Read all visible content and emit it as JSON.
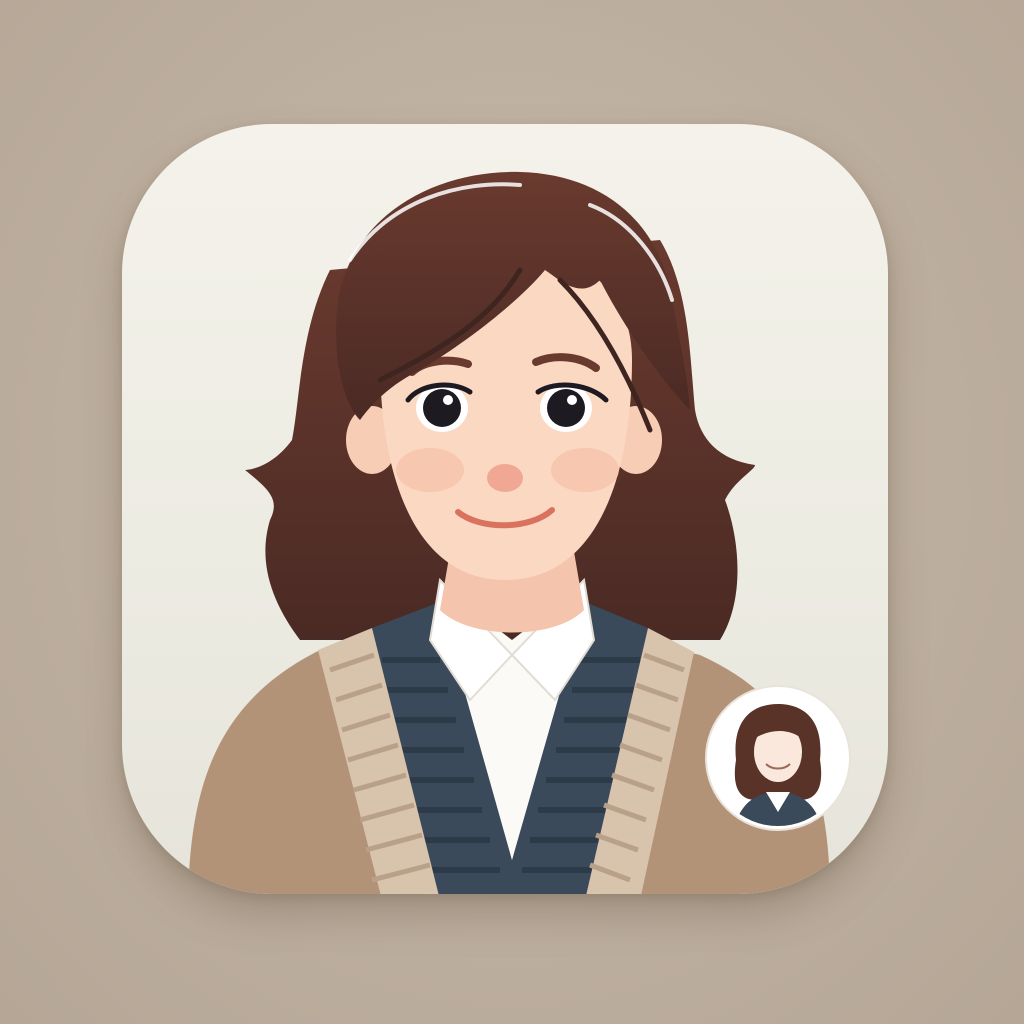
{
  "icon": {
    "subject": "avatar",
    "badge": "avatar-badge"
  },
  "colors": {
    "background": "#bfb1a1",
    "tile": "#f2f0e8",
    "hair": "#5a3328",
    "hair_shadow": "#3e2520",
    "skin": "#fbd8c2",
    "blush": "#f5b9a3",
    "cardigan": "#b39378",
    "cardigan_trim": "#d8c3ad",
    "vest": "#3a4a5a",
    "shirt": "#fbfaf7",
    "badge_bg": "#ffffff"
  }
}
